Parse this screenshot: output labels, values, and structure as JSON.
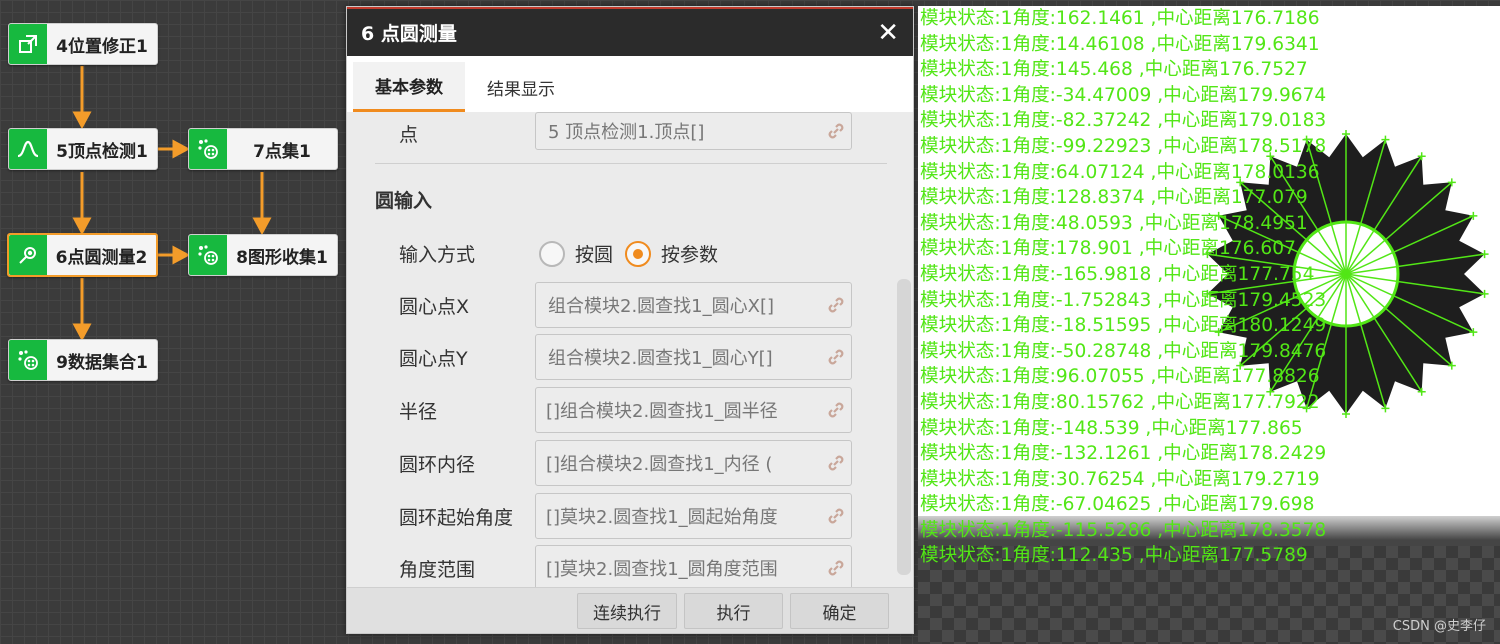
{
  "flow": {
    "nodes": [
      {
        "label": "4位置修正1",
        "icon": "position-correction-icon"
      },
      {
        "label": "5顶点检测1",
        "icon": "peak-detection-icon"
      },
      {
        "label": "7点集1",
        "icon": "point-set-icon"
      },
      {
        "label": "6点圆测量2",
        "icon": "circle-measure-icon"
      },
      {
        "label": "8图形收集1",
        "icon": "shape-collect-icon"
      },
      {
        "label": "9数据集合1",
        "icon": "data-set-icon"
      }
    ]
  },
  "dialog": {
    "title": "6 点圆测量",
    "close": "✕",
    "tabs": [
      {
        "label": "基本参数",
        "active": true
      },
      {
        "label": "结果显示",
        "active": false
      }
    ],
    "point": {
      "label": "点",
      "value": "5 顶点检测1.顶点[]"
    },
    "section_title": "圆输入",
    "input_mode": {
      "label": "输入方式",
      "options": [
        {
          "label": "按圆",
          "checked": false
        },
        {
          "label": "按参数",
          "checked": true
        }
      ]
    },
    "fields": [
      {
        "label": "圆心点X",
        "value": "组合模块2.圆查找1_圆心X[]"
      },
      {
        "label": "圆心点Y",
        "value": "组合模块2.圆查找1_圆心Y[]"
      },
      {
        "label": "半径",
        "value": "组合模块2.圆查找1_圆半径[]"
      },
      {
        "label": "圆环内径",
        "value": ") 组合模块2.圆查找1_内径[]"
      },
      {
        "label": "圆环起始角度",
        "value": "莫块2.圆查找1_圆起始角度[]"
      },
      {
        "label": "角度范围",
        "value": "莫块2.圆查找1_圆角度范围[]"
      }
    ],
    "buttons": {
      "run_continuous": "连续执行",
      "run": "执行",
      "ok": "确定"
    },
    "accent_color": "#f08b1e"
  },
  "results": {
    "color": "#52e616",
    "lines": [
      "模块状态:1角度:162.1461 ,中心距离176.7186",
      "模块状态:1角度:14.46108 ,中心距离179.6341",
      "模块状态:1角度:145.468 ,中心距离176.7527",
      "模块状态:1角度:-34.47009 ,中心距离179.9674",
      "模块状态:1角度:-82.37242 ,中心距离179.0183",
      "模块状态:1角度:-99.22923 ,中心距离178.5178",
      "模块状态:1角度:64.07124 ,中心距离178.0136",
      "模块状态:1角度:128.8374 ,中心距离177.079",
      "模块状态:1角度:48.0593 ,中心距离178.4951",
      "模块状态:1角度:178.901 ,中心距离176.607",
      "模块状态:1角度:-165.9818 ,中心距离177.754",
      "模块状态:1角度:-1.752843 ,中心距离179.4523",
      "模块状态:1角度:-18.51595 ,中心距离180.1249",
      "模块状态:1角度:-50.28748 ,中心距离179.8476",
      "模块状态:1角度:96.07055 ,中心距离177.8826",
      "模块状态:1角度:80.15762 ,中心距离177.7922",
      "模块状态:1角度:-148.539 ,中心距离177.865",
      "模块状态:1角度:-132.1261 ,中心距离178.2429",
      "模块状态:1角度:30.76254 ,中心距离179.2719",
      "模块状态:1角度:-67.04625 ,中心距离179.698",
      "模块状态:1角度:-115.5286 ,中心距离178.3578",
      "模块状态:1角度:112.435 ,中心距离177.5789"
    ]
  },
  "watermark": "CSDN @史李仔"
}
